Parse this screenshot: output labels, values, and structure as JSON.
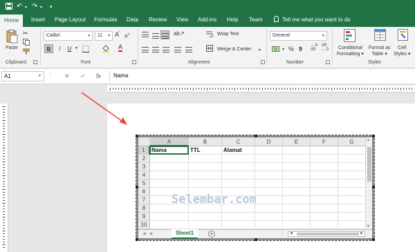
{
  "quick_access": {
    "undo": "↶",
    "redo": "↷",
    "customize": "▾"
  },
  "tabs": [
    "Home",
    "Insert",
    "Page Layout",
    "Formulas",
    "Data",
    "Review",
    "View",
    "Add-ins",
    "Help",
    "Team"
  ],
  "active_tab": "Home",
  "tell_me": "Tell me what you want to do",
  "ribbon": {
    "clipboard": {
      "paste": "Paste",
      "label": "Clipboard"
    },
    "font": {
      "name": "Calibri",
      "size": "11",
      "grow": "A",
      "shrink": "A",
      "bold": "B",
      "italic": "I",
      "underline": "U",
      "font_color": "A",
      "label": "Font"
    },
    "alignment": {
      "wrap_text": "Wrap Text",
      "merge_center": "Merge & Center",
      "label": "Alignment"
    },
    "number": {
      "format": "General",
      "currency": "$",
      "percent": "%",
      "comma": "9",
      "inc_decimal": ".00",
      "dec_decimal": ".00",
      "inc_decimal_2": "→.0",
      "dec_decimal_2": "←.0",
      "label": "Number"
    },
    "styles": {
      "conditional": "Conditional",
      "conditional2": "Formatting",
      "format_as": "Format as",
      "format_as2": "Table",
      "cell": "Cell",
      "cell2": "Styles",
      "label": "Styles"
    }
  },
  "formula_bar": {
    "name_box": "A1",
    "cancel": "✕",
    "enter": "✓",
    "fx": "fx",
    "value": "Nama"
  },
  "sheet": {
    "columns": [
      "A",
      "B",
      "C",
      "D",
      "E",
      "F",
      "G"
    ],
    "rows": [
      "1",
      "2",
      "3",
      "4",
      "5",
      "6",
      "7",
      "8",
      "9",
      "10"
    ],
    "cells": {
      "A1": "Nama",
      "B1": "TTL",
      "C1": "Alamat"
    },
    "sheet_tab": "Sheet1",
    "add_sheet": "+"
  },
  "watermark": "Selembar.com",
  "colors": {
    "excel_green": "#217346",
    "arrow": "#e8473a"
  }
}
